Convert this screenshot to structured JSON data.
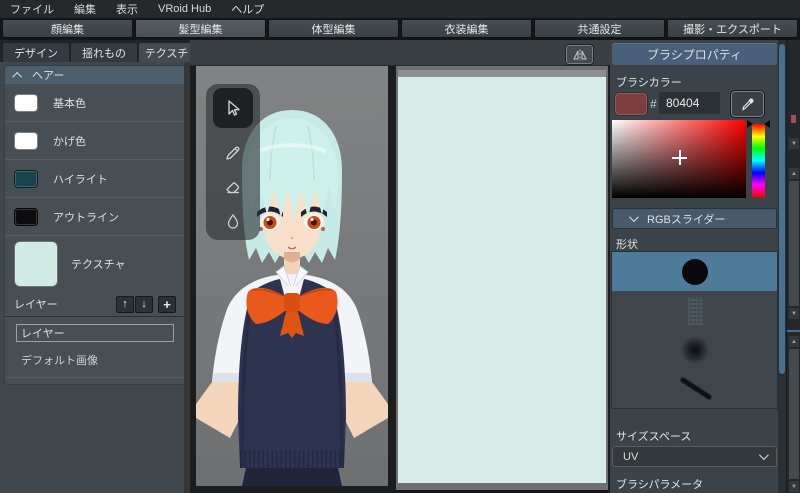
{
  "menu_bar": {
    "items": [
      "ファイル",
      "編集",
      "表示",
      "VRoid Hub",
      "ヘルプ"
    ]
  },
  "main_tabs": {
    "active": "髪型編集",
    "items": [
      {
        "label": "顔編集"
      },
      {
        "label": "髪型編集"
      },
      {
        "label": "体型編集"
      },
      {
        "label": "衣装編集"
      },
      {
        "label": "共通設定"
      },
      {
        "label": "撮影・エクスポート"
      }
    ]
  },
  "left_panel": {
    "tabs": [
      {
        "label": "デザイン"
      },
      {
        "label": "揺れもの"
      },
      {
        "label": "テクスチャ",
        "active": true
      }
    ],
    "hair_section": {
      "title": "ヘアー",
      "items": [
        {
          "label": "基本色",
          "color": "#fdfdfd"
        },
        {
          "label": "かげ色",
          "color": "#fdfdfd"
        },
        {
          "label": "ハイライト",
          "color": "#17444d"
        },
        {
          "label": "アウトライン",
          "color": "#0d0d0d"
        },
        {
          "label": "テクスチャ",
          "color": "#cfe9e4"
        }
      ]
    },
    "layers": {
      "title": "レイヤー",
      "buttons": {
        "up": "↑",
        "down": "↓",
        "add": "+"
      },
      "items": [
        {
          "label": "レイヤー",
          "selected": true
        },
        {
          "label": "デフォルト画像",
          "selected": false
        }
      ]
    }
  },
  "canvas": {
    "texture_color": "#d8edea"
  },
  "viewport": {
    "tools": [
      "select-cursor",
      "pencil",
      "eraser",
      "eyedropper"
    ],
    "selected_tool": "select-cursor",
    "mirror_button": "horizontal-symmetry"
  },
  "right_panel": {
    "title": "ブラシプロパティ",
    "brush_color": {
      "label": "ブラシカラー",
      "hash": "#",
      "hex": "80404",
      "swatch": "#7e3e3e"
    },
    "rgb_section": "RGBスライダー",
    "shape": {
      "label": "形状",
      "items": [
        "circle",
        "noise",
        "soft-dot",
        "stroke"
      ],
      "selected_index": 0
    },
    "size_space": {
      "label": "サイズスペース",
      "value": "UV"
    },
    "brush_params_label": "ブラシパラメータ"
  }
}
